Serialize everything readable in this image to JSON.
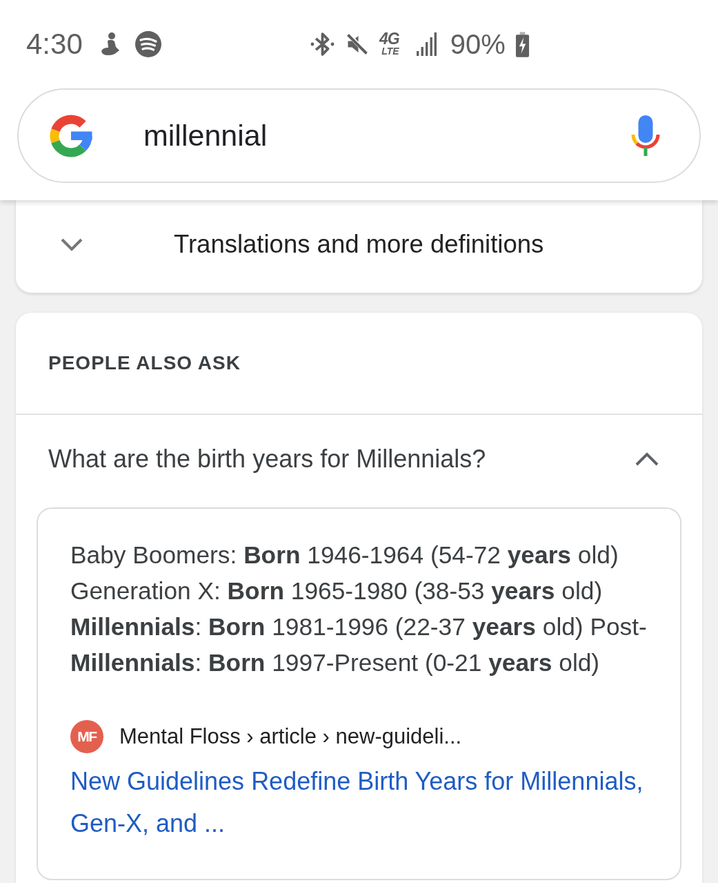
{
  "status_bar": {
    "time": "4:30",
    "network": {
      "generation": "4G",
      "technology": "LTE"
    },
    "battery": "90%",
    "charging": true
  },
  "search": {
    "value": "millennial"
  },
  "definitions": {
    "label": "Translations and more definitions",
    "expanded": false
  },
  "people_also_ask": {
    "heading": "PEOPLE ALSO ASK",
    "questions": [
      {
        "text": "What are the birth years for Millennials?",
        "expanded": true,
        "answer": {
          "snippet": "Baby Boomers: **Born** 1946-1964 (54-72 **years** old) Generation X: **Born** 1965-1980 (38-53 **years** old) **Millennials**: **Born** 1981-1996 (22-37 **years** old) Post-**Millennials**: **Born** 1997-Present (0-21 **years** old)",
          "source": {
            "favicon": "MF",
            "breadcrumb": "Mental Floss › article › new-guideli...",
            "title": "New Guidelines Redefine Birth Years for Millennials, Gen-X, and ..."
          }
        }
      }
    ]
  }
}
